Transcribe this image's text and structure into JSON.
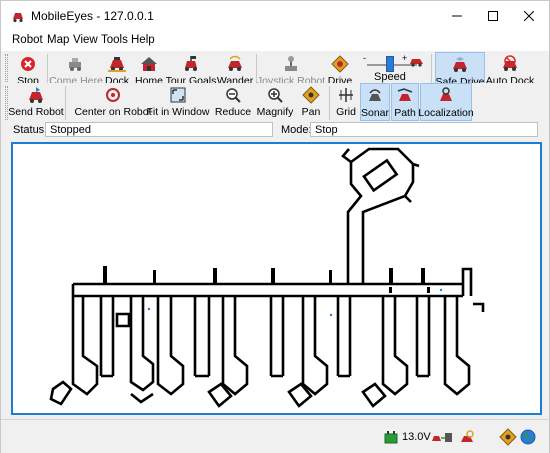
{
  "window": {
    "title": "MobileEyes - 127.0.0.1"
  },
  "menu": [
    {
      "label": "Robot"
    },
    {
      "label": "Map"
    },
    {
      "label": "View"
    },
    {
      "label": "Tools"
    },
    {
      "label": "Help"
    }
  ],
  "toolbar1": {
    "stop": "Stop",
    "come_here": "Come Here",
    "dock": "Dock",
    "home": "Home",
    "tour_goals": "Tour Goals",
    "wander": "Wander",
    "joystick_robot": "Joystick Robot",
    "drive": "Drive",
    "speed": "Speed",
    "speed_value": 0.45,
    "safe_drive": "Safe Drive",
    "auto_dock": "Auto Dock"
  },
  "toolbar2": {
    "send_robot": "Send Robot",
    "center_on_robot": "Center on Robot",
    "fit_in_window": "Fit in Window",
    "reduce": "Reduce",
    "magnify": "Magnify",
    "pan": "Pan",
    "grid": "Grid",
    "sonar": "Sonar",
    "path": "Path",
    "localization": "Localization"
  },
  "status": {
    "label": "Status:",
    "value": "Stopped"
  },
  "mode": {
    "label": "Mode:",
    "value": "Stop"
  },
  "bottom": {
    "voltage": "13.0V"
  },
  "colors": {
    "accent": "#1d7cd4",
    "active": "#c9e0f7",
    "stop_red": "#d9262b"
  }
}
